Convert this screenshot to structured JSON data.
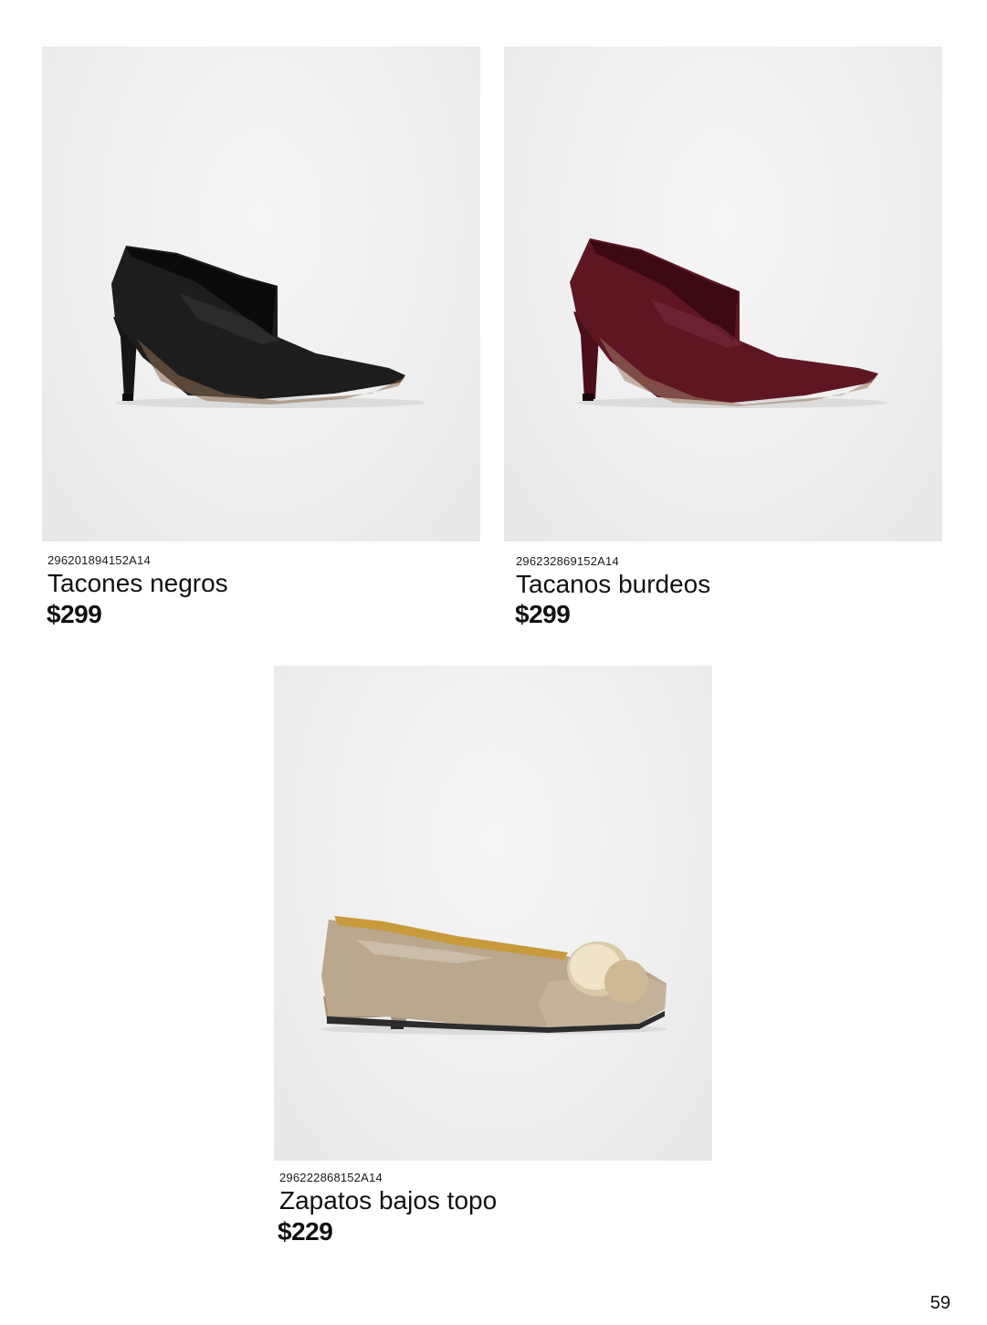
{
  "products": [
    {
      "sku": "296201894152A14",
      "name": "Tacones negros",
      "price": "$299",
      "image": {
        "icon": "black-pointed-heel-shoe-icon",
        "color": "#1b1b1b"
      }
    },
    {
      "sku": "296232869152A14",
      "name": "Tacanos burdeos",
      "price": "$299",
      "image": {
        "icon": "burgundy-pointed-heel-shoe-icon",
        "color": "#5e1623"
      }
    },
    {
      "sku": "296222868152A14",
      "name": "Zapatos bajos topo",
      "price": "$229",
      "image": {
        "icon": "taupe-flat-shoe-icon",
        "color": "#b9a78e"
      }
    }
  ],
  "page": {
    "number": "59"
  }
}
